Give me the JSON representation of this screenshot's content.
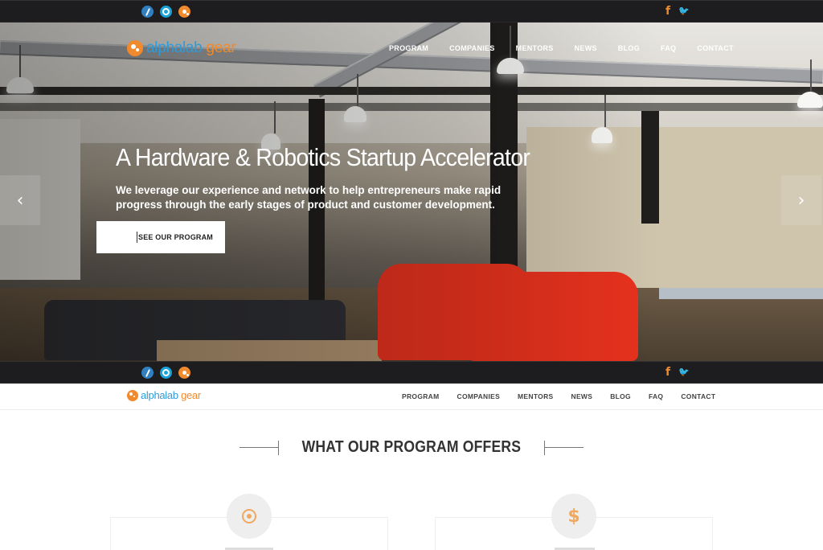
{
  "topbar": {
    "social": {
      "facebook": "f",
      "twitter": "🐦"
    }
  },
  "hero": {
    "logo": {
      "part1": "alphalab",
      "part2": " gear"
    },
    "nav": [
      "PROGRAM",
      "COMPANIES",
      "MENTORS",
      "NEWS",
      "BLOG",
      "FAQ",
      "CONTACT"
    ],
    "title": "A Hardware & Robotics Startup Accelerator",
    "subtitle": "We leverage our experience and network to help entrepreneurs make rapid progress through the early stages of product and customer development.",
    "cta": "SEE OUR PROGRAM",
    "prev_arrow": "‹",
    "next_arrow": "›"
  },
  "header2": {
    "logo": {
      "part1": "alphalab",
      "part2": " gear"
    },
    "nav": [
      "PROGRAM",
      "COMPANIES",
      "MENTORS",
      "NEWS",
      "BLOG",
      "FAQ",
      "CONTACT"
    ]
  },
  "section": {
    "title": "WHAT OUR PROGRAM OFFERS",
    "icon2": "$"
  },
  "colors": {
    "accent_orange": "#f08a2c",
    "accent_blue": "#2f9bd8",
    "topbar_bg": "#1d1d1f"
  }
}
